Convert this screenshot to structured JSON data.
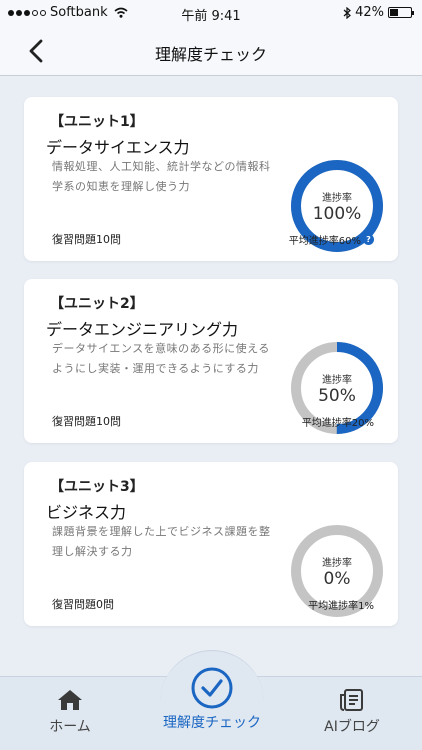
{
  "status_bar": {
    "carrier": "Softbank",
    "time": "午前 9:41",
    "battery": "42%",
    "battery_level": 0.42
  },
  "nav": {
    "title": "理解度チェック"
  },
  "units": [
    {
      "label": "【ユニット1】",
      "title": "データサイエンス力",
      "description": "情報処理、人工知能、統計学などの情報科学系の知恵を理解し使う力",
      "review_count": "復習問題10問",
      "progress_label": "進捗率",
      "progress_text": "100%",
      "progress": 1.0,
      "average": "平均進捗率60%"
    },
    {
      "label": "【ユニット2】",
      "title": "データエンジニアリング力",
      "description": "データサイエンスを意味のある形に使えるようにし実装・運用できるようにする力",
      "review_count": "復習問題10問",
      "progress_label": "進捗率",
      "progress_text": "50%",
      "progress": 0.5,
      "average": "平均進捗率20%"
    },
    {
      "label": "【ユニット3】",
      "title": "ビジネス力",
      "description": "課題背景を理解した上でビジネス課題を整理し解決する力",
      "review_count": "復習問題0問",
      "progress_label": "進捗率",
      "progress_text": "0%",
      "progress": 0.0,
      "average": "平均進捗率1%"
    }
  ],
  "tabs": [
    {
      "label": "ホーム",
      "icon": "home-icon"
    },
    {
      "label": "理解度チェック",
      "icon": "check-circle-icon",
      "active": true
    },
    {
      "label": "AIブログ",
      "icon": "blog-icon"
    }
  ],
  "colors": {
    "accent": "#1a66c2",
    "ring_track": "#c4c4c4",
    "background": "#e9eef5"
  }
}
